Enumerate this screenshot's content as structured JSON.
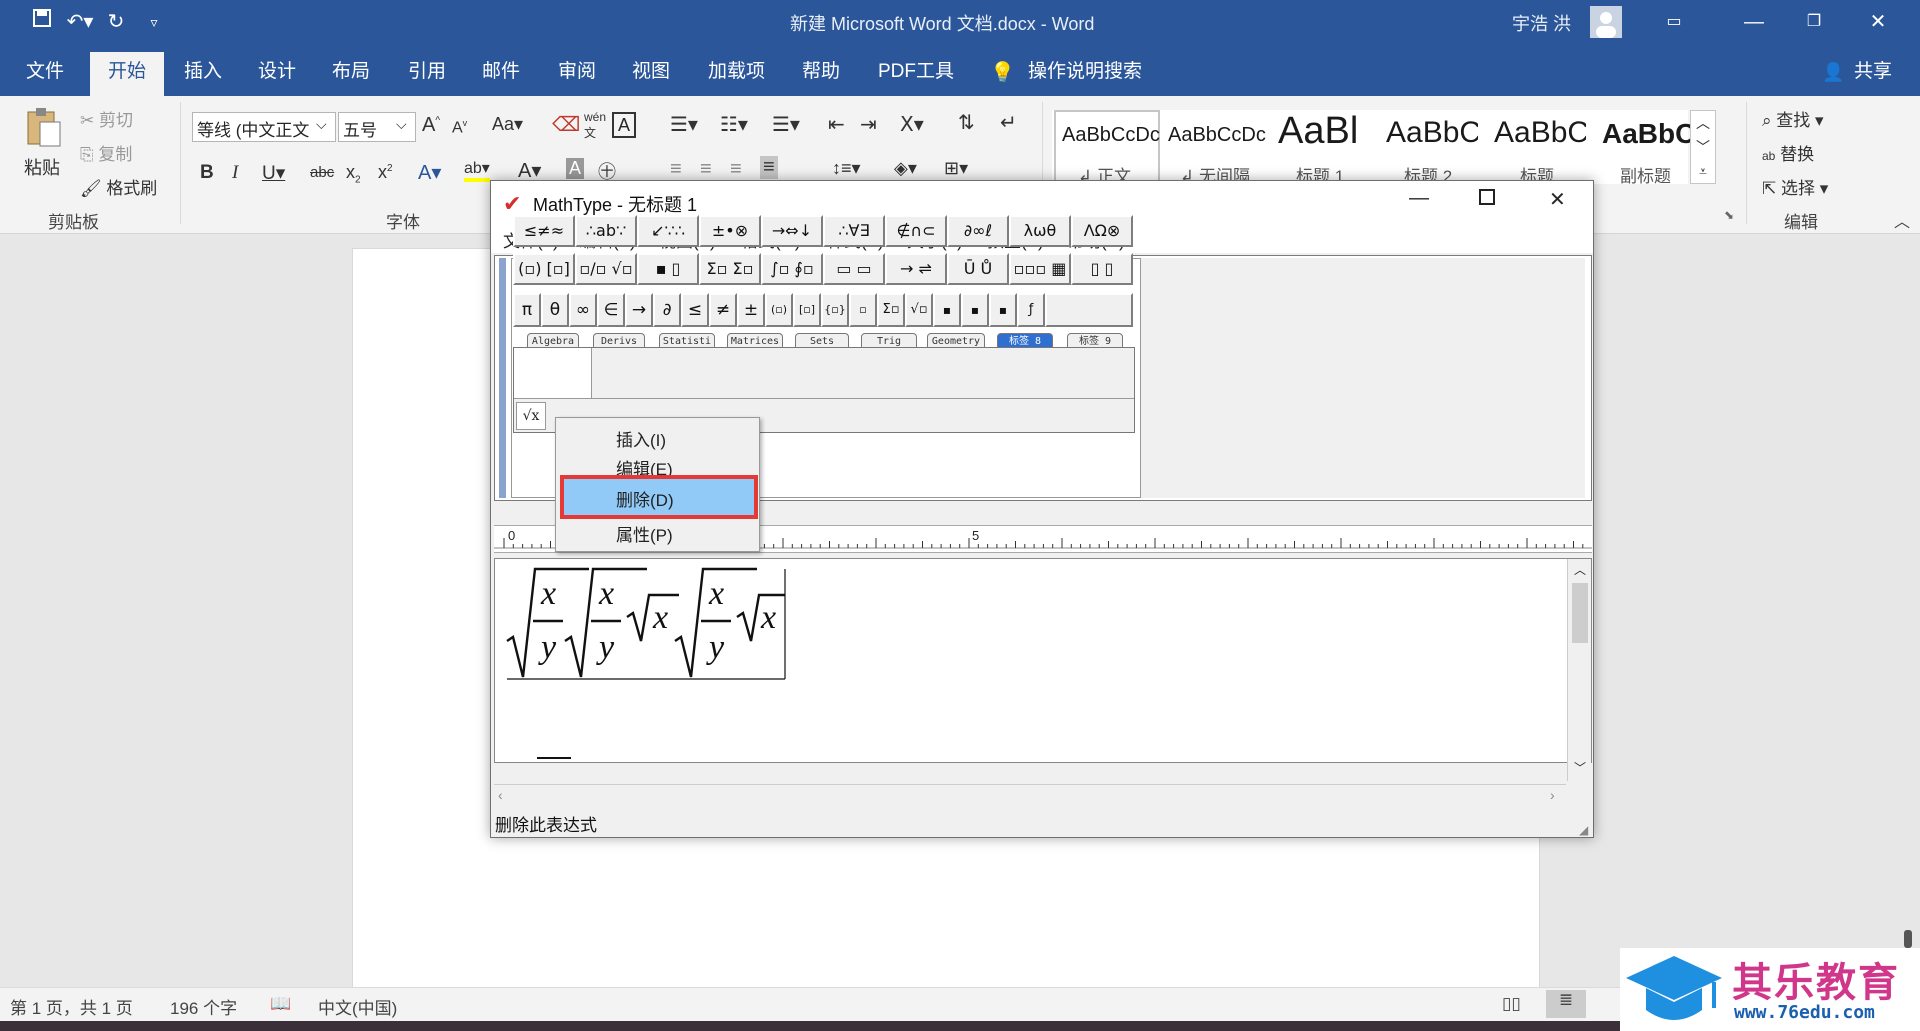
{
  "word": {
    "window_title": "新建 Microsoft Word 文档.docx  -  Word",
    "user": "宇浩 洪",
    "tabs": [
      "文件",
      "开始",
      "插入",
      "设计",
      "布局",
      "引用",
      "邮件",
      "审阅",
      "视图",
      "加载项",
      "帮助",
      "PDF工具"
    ],
    "tell_me": "操作说明搜索",
    "share": "共享",
    "clipboard": {
      "paste": "粘贴",
      "cut": "剪切",
      "copy": "复制",
      "format_painter": "格式刷",
      "group": "剪贴板"
    },
    "font": {
      "name": "等线 (中文正文",
      "size": "五号",
      "group": "字体",
      "aa": "Aa"
    },
    "styles": [
      "AaBbCcDc",
      "AaBbCcDc",
      "AaBl",
      "AaBbC",
      "AaBbC",
      "AaBbC"
    ],
    "style_names": [
      "正文",
      "无间隔",
      "标题 1",
      "标题 2",
      "标题",
      "副标题"
    ],
    "editing": {
      "find": "查找",
      "replace": "替换",
      "select": "选择",
      "group": "编辑"
    },
    "status": {
      "page": "第 1 页，共 1 页",
      "words": "196 个字",
      "lang": "中文(中国)"
    }
  },
  "mathtype": {
    "title": "MathType - 无标题 1",
    "menus": [
      "文件(F)",
      "编辑(E)",
      "视图(V)",
      "格式(M)",
      "样式(S)",
      "大小(Z)",
      "预置(P)",
      "帮助(H)"
    ],
    "row1": [
      "≤≠≈",
      "∴ab∵",
      "↙∵∴",
      "±•⊗",
      "→⇔↓",
      "∴∀∃",
      "∉∩⊂",
      "∂∞ℓ",
      "λωθ",
      "ΛΩ⊗"
    ],
    "row2": [
      "(▫) [▫]",
      "▫/▫ √▫",
      "▪ ▯",
      "Σ▫ Σ▫",
      "∫▫ ∮▫",
      "▭ ▭",
      "→ ⇌",
      "Ū Ů",
      "▫▫▫ ▦",
      "▯ ▯"
    ],
    "symbols": [
      "π",
      "θ",
      "∞",
      "∈",
      "→",
      "∂",
      "≤",
      "≠",
      "±",
      "(▫)",
      "[▫]",
      "{▫}",
      "▫",
      "Σ▫",
      "√▫",
      "▪",
      "▪",
      "▪",
      "ƒ"
    ],
    "template_tabs": [
      "Algebra",
      "Derivs",
      "Statisti",
      "Matrices",
      "Sets",
      "Trig",
      "Geometry",
      "标签 8",
      "标签 9"
    ],
    "context_menu": [
      "插入(I)",
      "编辑(E)",
      "删除(D)",
      "属性(P)"
    ],
    "ruler_marks": [
      "0",
      "5"
    ],
    "math_vars": {
      "x": "x",
      "y": "y"
    },
    "status": "删除此表达式"
  },
  "watermark": {
    "name": "其乐教育",
    "url": "www.76edu.com"
  }
}
